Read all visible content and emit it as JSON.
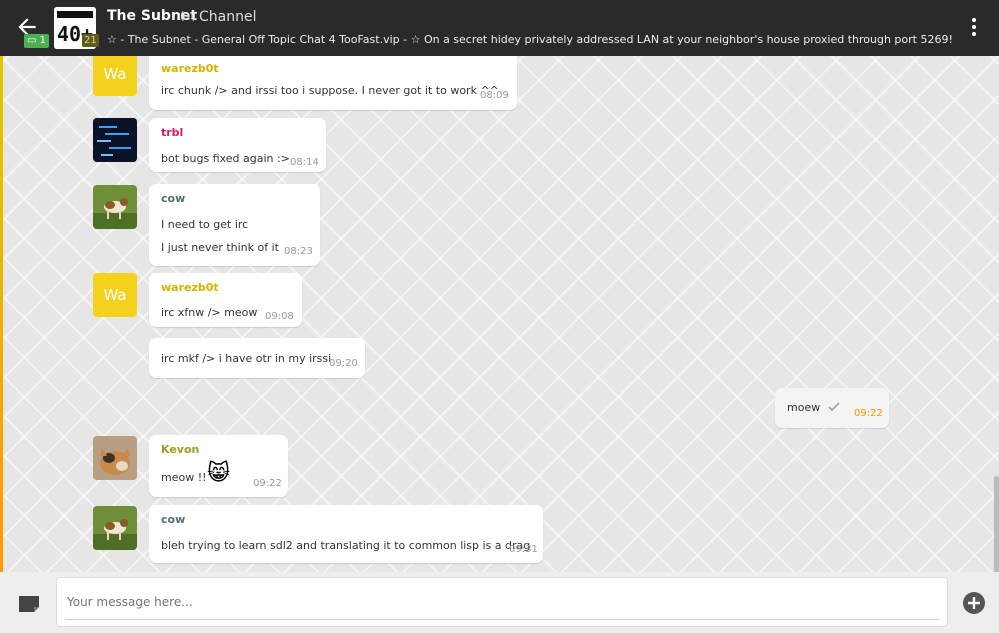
{
  "header": {
    "unread_count": "1",
    "channel_member_count": "21",
    "title": "The Subnet",
    "channel_label": "Channel",
    "topic": "☆ - The Subnet - General Off Topic Chat 4 TooFast.vip - ☆ On a secret hidey privately addressed LAN at your neighbor's house proxied through port 5269!"
  },
  "messages": [
    {
      "sender": "warezb0t",
      "avatar_text": "Wa",
      "lines": [
        "irc chunk /> and irssi too i suppose.  I never got it to work ^^"
      ],
      "time": "08:09"
    },
    {
      "sender": "trbl",
      "lines": [
        "bot bugs fixed again :>"
      ],
      "time": "08:14"
    },
    {
      "sender": "cow",
      "lines": [
        "I need to get irc",
        "I just never think of it"
      ],
      "time": "08:23"
    },
    {
      "sender": "warezb0t",
      "avatar_text": "Wa",
      "lines": [
        "irc xfnw /> meow"
      ],
      "time": "09:08"
    },
    {
      "lines": [
        "irc mkf /> i have otr in my irssi"
      ],
      "time": "09:20"
    },
    {
      "outgoing": true,
      "lines": [
        "moew"
      ],
      "time": "09:22"
    },
    {
      "sender": "Kevon",
      "lines": [
        "meow !!"
      ],
      "emoji": "😸",
      "time": "09:22"
    },
    {
      "sender": "cow",
      "lines": [
        "bleh trying to learn sdl2 and translating it to common lisp is a drag"
      ],
      "time": "09:31"
    }
  ],
  "colors": {
    "warezb0t": "#d4b400",
    "trbl": "#d81b60",
    "cow": "#546e7a",
    "Kevon": "#9e9d24",
    "out_time": "#f0a000"
  },
  "composer": {
    "placeholder": "Your message here..."
  }
}
